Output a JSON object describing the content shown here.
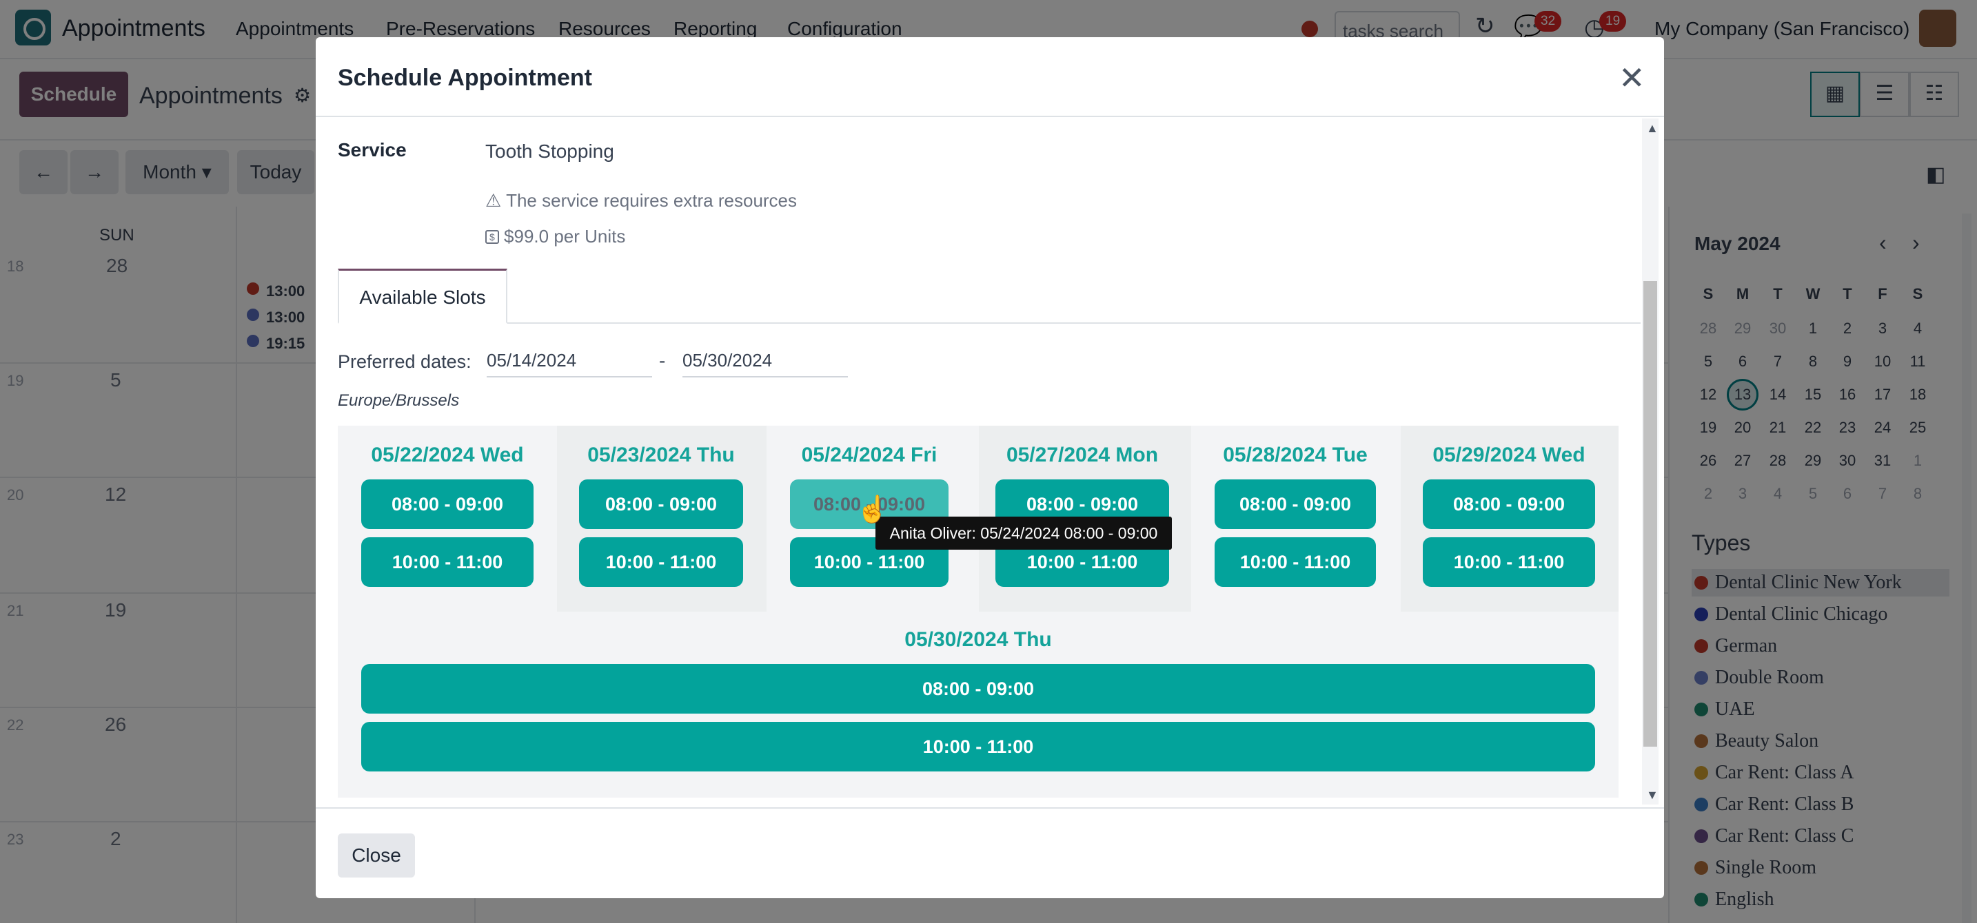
{
  "navbar": {
    "app_name": "Appointments",
    "menus": [
      "Appointments",
      "Pre-Reservations",
      "Resources",
      "Reporting",
      "Configuration"
    ],
    "search_placeholder": "tasks search",
    "messages_badge": "32",
    "activities_badge": "19",
    "company": "My Company (San Francisco)"
  },
  "control_panel": {
    "schedule_label": "Schedule",
    "breadcrumb": "Appointments",
    "period_label": "Month",
    "today_label": "Today",
    "views": [
      "calendar-icon",
      "list-icon",
      "gantt-icon"
    ]
  },
  "calendar": {
    "day_header": "SUN",
    "weeks": [
      {
        "week": "18",
        "day": "28"
      },
      {
        "week": "19",
        "day": "5"
      },
      {
        "week": "20",
        "day": "12"
      },
      {
        "week": "21",
        "day": "19"
      },
      {
        "week": "22",
        "day": "26"
      },
      {
        "week": "23",
        "day": "2"
      }
    ],
    "events": [
      {
        "time": "13:00",
        "color": "#c0392b"
      },
      {
        "time": "13:00",
        "color": "#5b6fc0"
      },
      {
        "time": "19:15",
        "color": "#5b6fc0"
      }
    ]
  },
  "mini_calendar": {
    "title": "May 2024",
    "weekdays": [
      "S",
      "M",
      "T",
      "W",
      "T",
      "F",
      "S"
    ],
    "rows": [
      [
        "28",
        "29",
        "30",
        "1",
        "2",
        "3",
        "4"
      ],
      [
        "5",
        "6",
        "7",
        "8",
        "9",
        "10",
        "11"
      ],
      [
        "12",
        "13",
        "14",
        "15",
        "16",
        "17",
        "18"
      ],
      [
        "19",
        "20",
        "21",
        "22",
        "23",
        "24",
        "25"
      ],
      [
        "26",
        "27",
        "28",
        "29",
        "30",
        "31",
        "1"
      ],
      [
        "2",
        "3",
        "4",
        "5",
        "6",
        "7",
        "8"
      ]
    ],
    "today": "13"
  },
  "types": {
    "title": "Types",
    "items": [
      {
        "label": "Dental Clinic New York",
        "color": "#c0392b"
      },
      {
        "label": "Dental Clinic Chicago",
        "color": "#2b3fb5"
      },
      {
        "label": "German",
        "color": "#c0392b"
      },
      {
        "label": "Double Room",
        "color": "#6b7fc9"
      },
      {
        "label": "UAE",
        "color": "#1f8a6e"
      },
      {
        "label": "Beauty Salon",
        "color": "#b5703a"
      },
      {
        "label": "Car Rent: Class A",
        "color": "#d4a330"
      },
      {
        "label": "Car Rent: Class B",
        "color": "#3b7dc4"
      },
      {
        "label": "Car Rent: Class C",
        "color": "#6b4c8a"
      },
      {
        "label": "Single Room",
        "color": "#b5703a"
      },
      {
        "label": "English",
        "color": "#1f8a6e"
      }
    ]
  },
  "modal": {
    "title": "Schedule Appointment",
    "service_label": "Service",
    "service_value": "Tooth Stopping",
    "warning": "The service requires extra resources",
    "price": "$99.0 per Units",
    "tab": "Available Slots",
    "preferred_label": "Preferred dates:",
    "date_from": "05/14/2024",
    "date_sep": "-",
    "date_to": "05/30/2024",
    "timezone": "Europe/Brussels",
    "days": [
      {
        "header": "05/22/2024 Wed",
        "slots": [
          "08:00 - 09:00",
          "10:00 - 11:00"
        ]
      },
      {
        "header": "05/23/2024 Thu",
        "slots": [
          "08:00 - 09:00",
          "10:00 - 11:00"
        ]
      },
      {
        "header": "05/24/2024 Fri",
        "slots": [
          "08:00 - 09:00",
          "10:00 - 11:00"
        ]
      },
      {
        "header": "05/27/2024 Mon",
        "slots": [
          "08:00 - 09:00",
          "10:00 - 11:00"
        ]
      },
      {
        "header": "05/28/2024 Tue",
        "slots": [
          "08:00 - 09:00",
          "10:00 - 11:00"
        ]
      },
      {
        "header": "05/29/2024 Wed",
        "slots": [
          "08:00 - 09:00",
          "10:00 - 11:00"
        ]
      }
    ],
    "last_day": {
      "header": "05/30/2024 Thu",
      "slots": [
        "08:00 - 09:00",
        "10:00 - 11:00"
      ]
    },
    "tooltip": "Anita Oliver: 05/24/2024 08:00 - 09:00",
    "close_label": "Close"
  }
}
